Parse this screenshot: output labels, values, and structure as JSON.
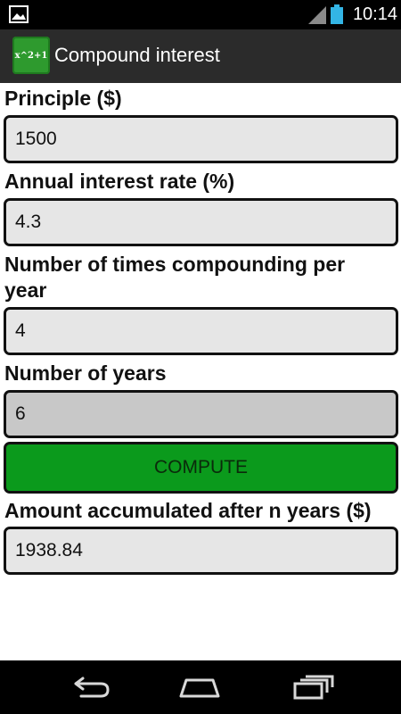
{
  "status_bar": {
    "time": "10:14"
  },
  "app": {
    "icon_text": "x^2+1",
    "title": "Compound interest"
  },
  "form": {
    "principle_label": "Principle ($)",
    "principle_value": "1500",
    "rate_label": "Annual interest rate (%)",
    "rate_value": "4.3",
    "times_label_line1": "Number of times compounding per",
    "times_label_line2": "year",
    "times_value": "4",
    "years_label": "Number of years",
    "years_value": "6",
    "compute_label": "COMPUTE",
    "result_label": "Amount accumulated after n years ($)",
    "result_value": "1938.84"
  },
  "colors": {
    "compute_button": "#0b9a1c",
    "app_icon": "#2e9a2e",
    "battery": "#33b5e5"
  },
  "icons": {
    "status_left": "gallery-icon",
    "signal": "signal-icon",
    "battery": "battery-icon",
    "nav_back": "back-icon",
    "nav_home": "home-icon",
    "nav_recent": "recent-apps-icon"
  }
}
